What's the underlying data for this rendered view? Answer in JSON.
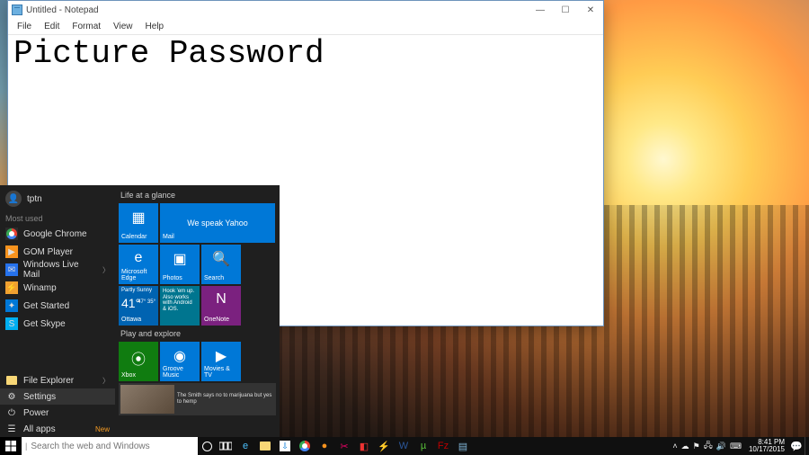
{
  "notepad": {
    "title": "Untitled - Notepad",
    "menu": {
      "file": "File",
      "edit": "Edit",
      "format": "Format",
      "view": "View",
      "help": "Help"
    },
    "content": "Picture Password",
    "win": {
      "min": "—",
      "max": "☐",
      "close": "✕"
    }
  },
  "start": {
    "user": "tptn",
    "sections": {
      "most_used": "Most used",
      "life": "Life at a glance",
      "play": "Play and explore"
    },
    "most_used": [
      {
        "label": "Google Chrome",
        "icon": "chrome"
      },
      {
        "label": "GOM Player",
        "icon": "gom"
      },
      {
        "label": "Windows Live Mail",
        "icon": "mail",
        "chev": true
      },
      {
        "label": "Winamp",
        "icon": "winamp"
      },
      {
        "label": "Get Started",
        "icon": "getstarted"
      },
      {
        "label": "Get Skype",
        "icon": "skype"
      }
    ],
    "bottom": [
      {
        "label": "File Explorer",
        "icon": "folder",
        "chev": true
      },
      {
        "label": "Settings",
        "icon": "gear"
      },
      {
        "label": "Power",
        "icon": "power"
      },
      {
        "label": "All apps",
        "icon": "allapps",
        "extra": "New"
      }
    ],
    "tiles": {
      "calendar": "Calendar",
      "mail": "Mail",
      "mail_text": "We speak Yahoo",
      "edge": "Microsoft Edge",
      "photos": "Photos",
      "search": "Search",
      "weather_cond": "Partly Sunny",
      "weather_temp": "41°",
      "weather_hilo": "47°  35°",
      "weather_city": "Ottawa",
      "phone": "Hook 'em up. Also works with Android & iOS.",
      "onenote": "OneNote",
      "xbox": "Xbox",
      "groove": "Groove Music",
      "movies": "Movies & TV",
      "news": "The Smith says no to marijuana but yes to hemp"
    },
    "colors": {
      "blue": "#0078d7",
      "darkteal": "#00758f",
      "purple": "#7b217f",
      "green": "#107c10",
      "darkblue": "#0063b1",
      "gray": "#2b2b2b"
    }
  },
  "taskbar": {
    "search_placeholder": "Search the web and Windows",
    "search_value": "",
    "clock_time": "8:41 PM",
    "clock_date": "10/17/2015",
    "tray_chevron": "˄"
  }
}
